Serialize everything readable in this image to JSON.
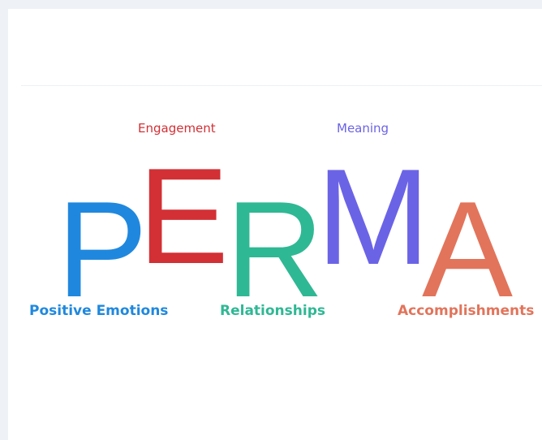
{
  "letters": {
    "p": "P",
    "e": "E",
    "r": "R",
    "m": "M",
    "a": "A"
  },
  "labels": {
    "engagement": "Engagement",
    "meaning": "Meaning",
    "positive_emotions": "Positive Emotions",
    "relationships": "Relationships",
    "accomplishments": "Accomplishments"
  },
  "colors": {
    "p": "#1f88de",
    "e": "#d23035",
    "r": "#2fb894",
    "m": "#6b63e6",
    "a": "#e2745b"
  }
}
